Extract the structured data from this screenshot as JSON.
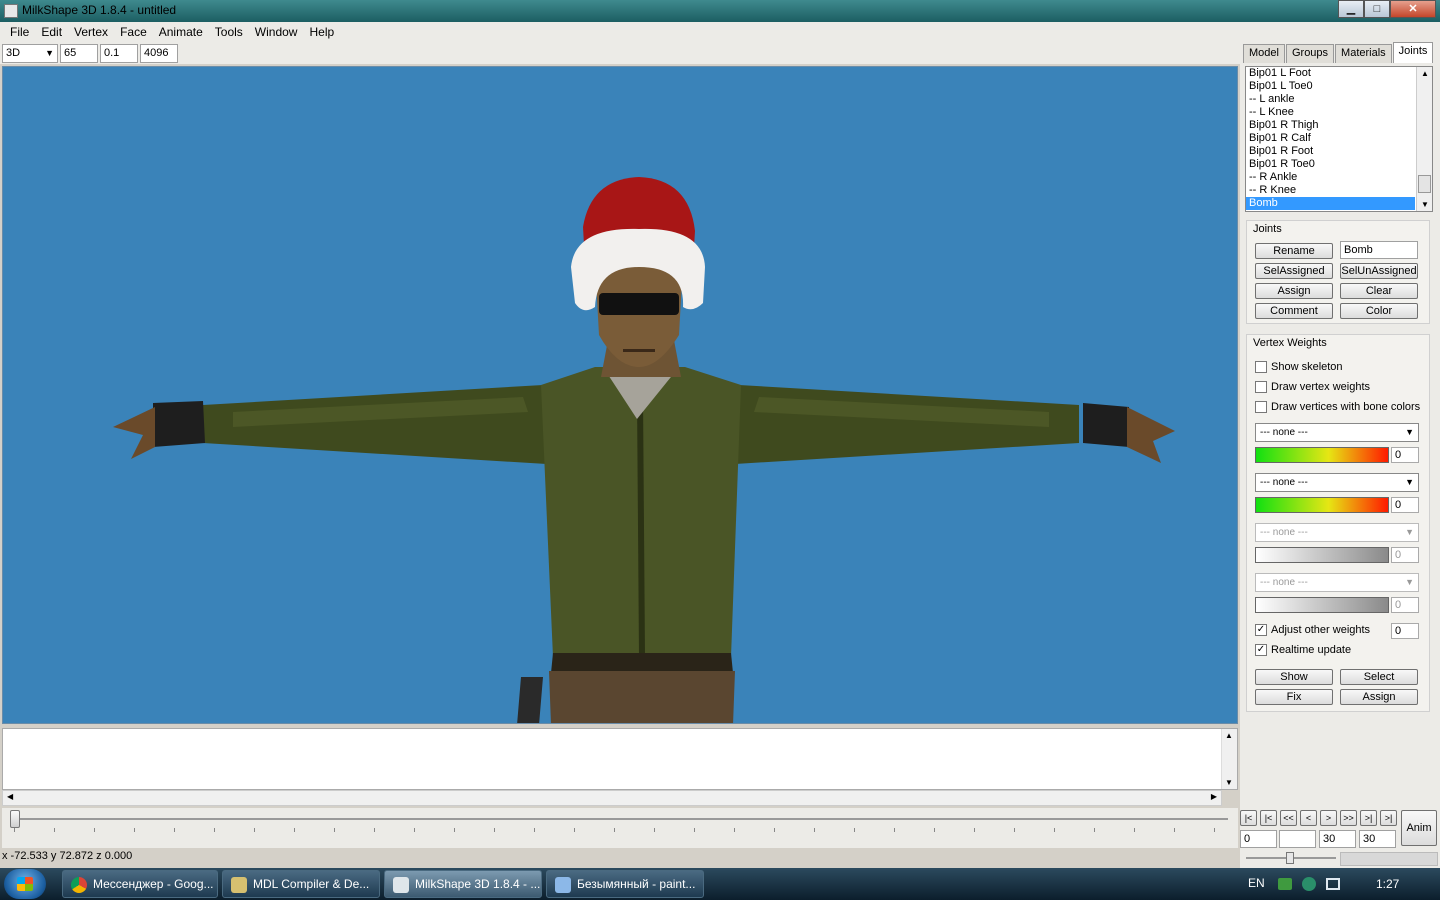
{
  "window": {
    "title": "MilkShape 3D 1.8.4 - untitled",
    "min": "▁",
    "max": "□",
    "close": "✕"
  },
  "menu": [
    "File",
    "Edit",
    "Vertex",
    "Face",
    "Animate",
    "Tools",
    "Window",
    "Help"
  ],
  "toolbar": {
    "view_mode": "3D",
    "field1": "65",
    "field2": "0.1",
    "field3": "4096"
  },
  "tabs": [
    "Model",
    "Groups",
    "Materials",
    "Joints"
  ],
  "active_tab": "Joints",
  "joints_list": [
    "Bip01 L Foot",
    "Bip01 L Toe0",
    "-- L ankle",
    "-- L Knee",
    "Bip01 R Thigh",
    "Bip01 R Calf",
    "Bip01 R Foot",
    "Bip01 R Toe0",
    "-- R Ankle",
    "-- R Knee",
    "Bomb"
  ],
  "selected_joint": "Bomb",
  "joints_group": {
    "label": "Joints",
    "rename": "Rename",
    "name_value": "Bomb",
    "sel_assigned": "SelAssigned",
    "sel_unassigned": "SelUnAssigned",
    "assign": "Assign",
    "clear": "Clear",
    "comment": "Comment",
    "color": "Color"
  },
  "vertex_weights": {
    "label": "Vertex Weights",
    "show_skeleton": "Show skeleton",
    "draw_vertex_weights": "Draw vertex weights",
    "draw_vertices_bone_colors": "Draw vertices with bone colors",
    "slots": [
      {
        "bone": "--- none ---",
        "weight": "0",
        "enabled": true
      },
      {
        "bone": "--- none ---",
        "weight": "0",
        "enabled": true
      },
      {
        "bone": "--- none ---",
        "weight": "0",
        "enabled": false
      },
      {
        "bone": "--- none ---",
        "weight": "0",
        "enabled": false
      }
    ],
    "adjust_other_weights": "Adjust other weights",
    "adjust_value": "0",
    "realtime_update": "Realtime update",
    "show": "Show",
    "select": "Select",
    "fix": "Fix",
    "assign": "Assign"
  },
  "anim": {
    "label": "Anim",
    "buttons": [
      "|<",
      "|<",
      "<<",
      "<",
      ">",
      ">>",
      ">|",
      ">|"
    ],
    "f1": "0",
    "f2": "",
    "f3": "30",
    "f4": "30"
  },
  "status": "x -72.533 y 72.872 z 0.000",
  "taskbar": {
    "items": [
      {
        "label": "Мессенджер - Goog...",
        "active": false
      },
      {
        "label": "MDL Compiler & De...",
        "active": false
      },
      {
        "label": "MilkShape 3D 1.8.4 - ...",
        "active": true
      },
      {
        "label": "Безымянный - paint...",
        "active": false
      }
    ],
    "lang": "EN",
    "time": "1:27"
  },
  "colors": {
    "viewport_bg": "#3a83b9",
    "selection": "#3399ff",
    "titlebar": "#2a7276"
  }
}
